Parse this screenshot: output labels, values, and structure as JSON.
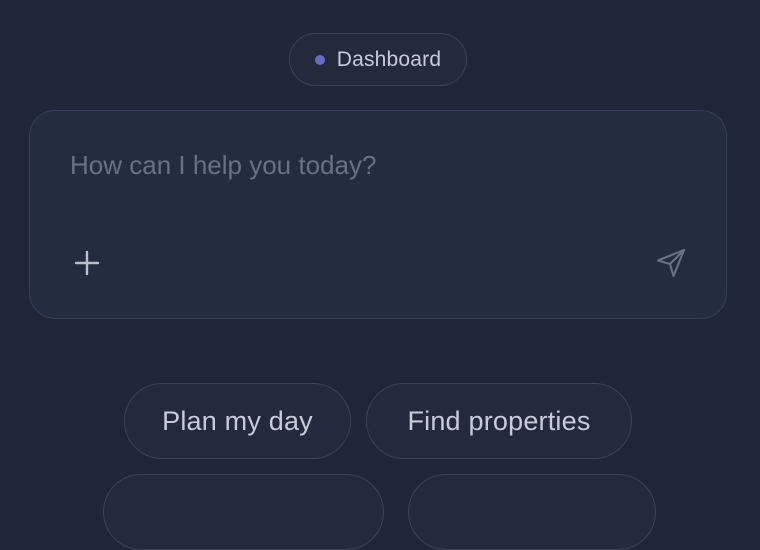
{
  "workspace_badge": {
    "label": "Dashboard",
    "dot_color": "#6b6bc4",
    "icon": "status-dot"
  },
  "composer": {
    "placeholder": "How can I help you today?",
    "value": "",
    "add_icon": "plus-icon",
    "send_icon": "send-icon"
  },
  "suggestions": [
    {
      "label": "Plan my day"
    },
    {
      "label": "Find properties"
    }
  ]
}
